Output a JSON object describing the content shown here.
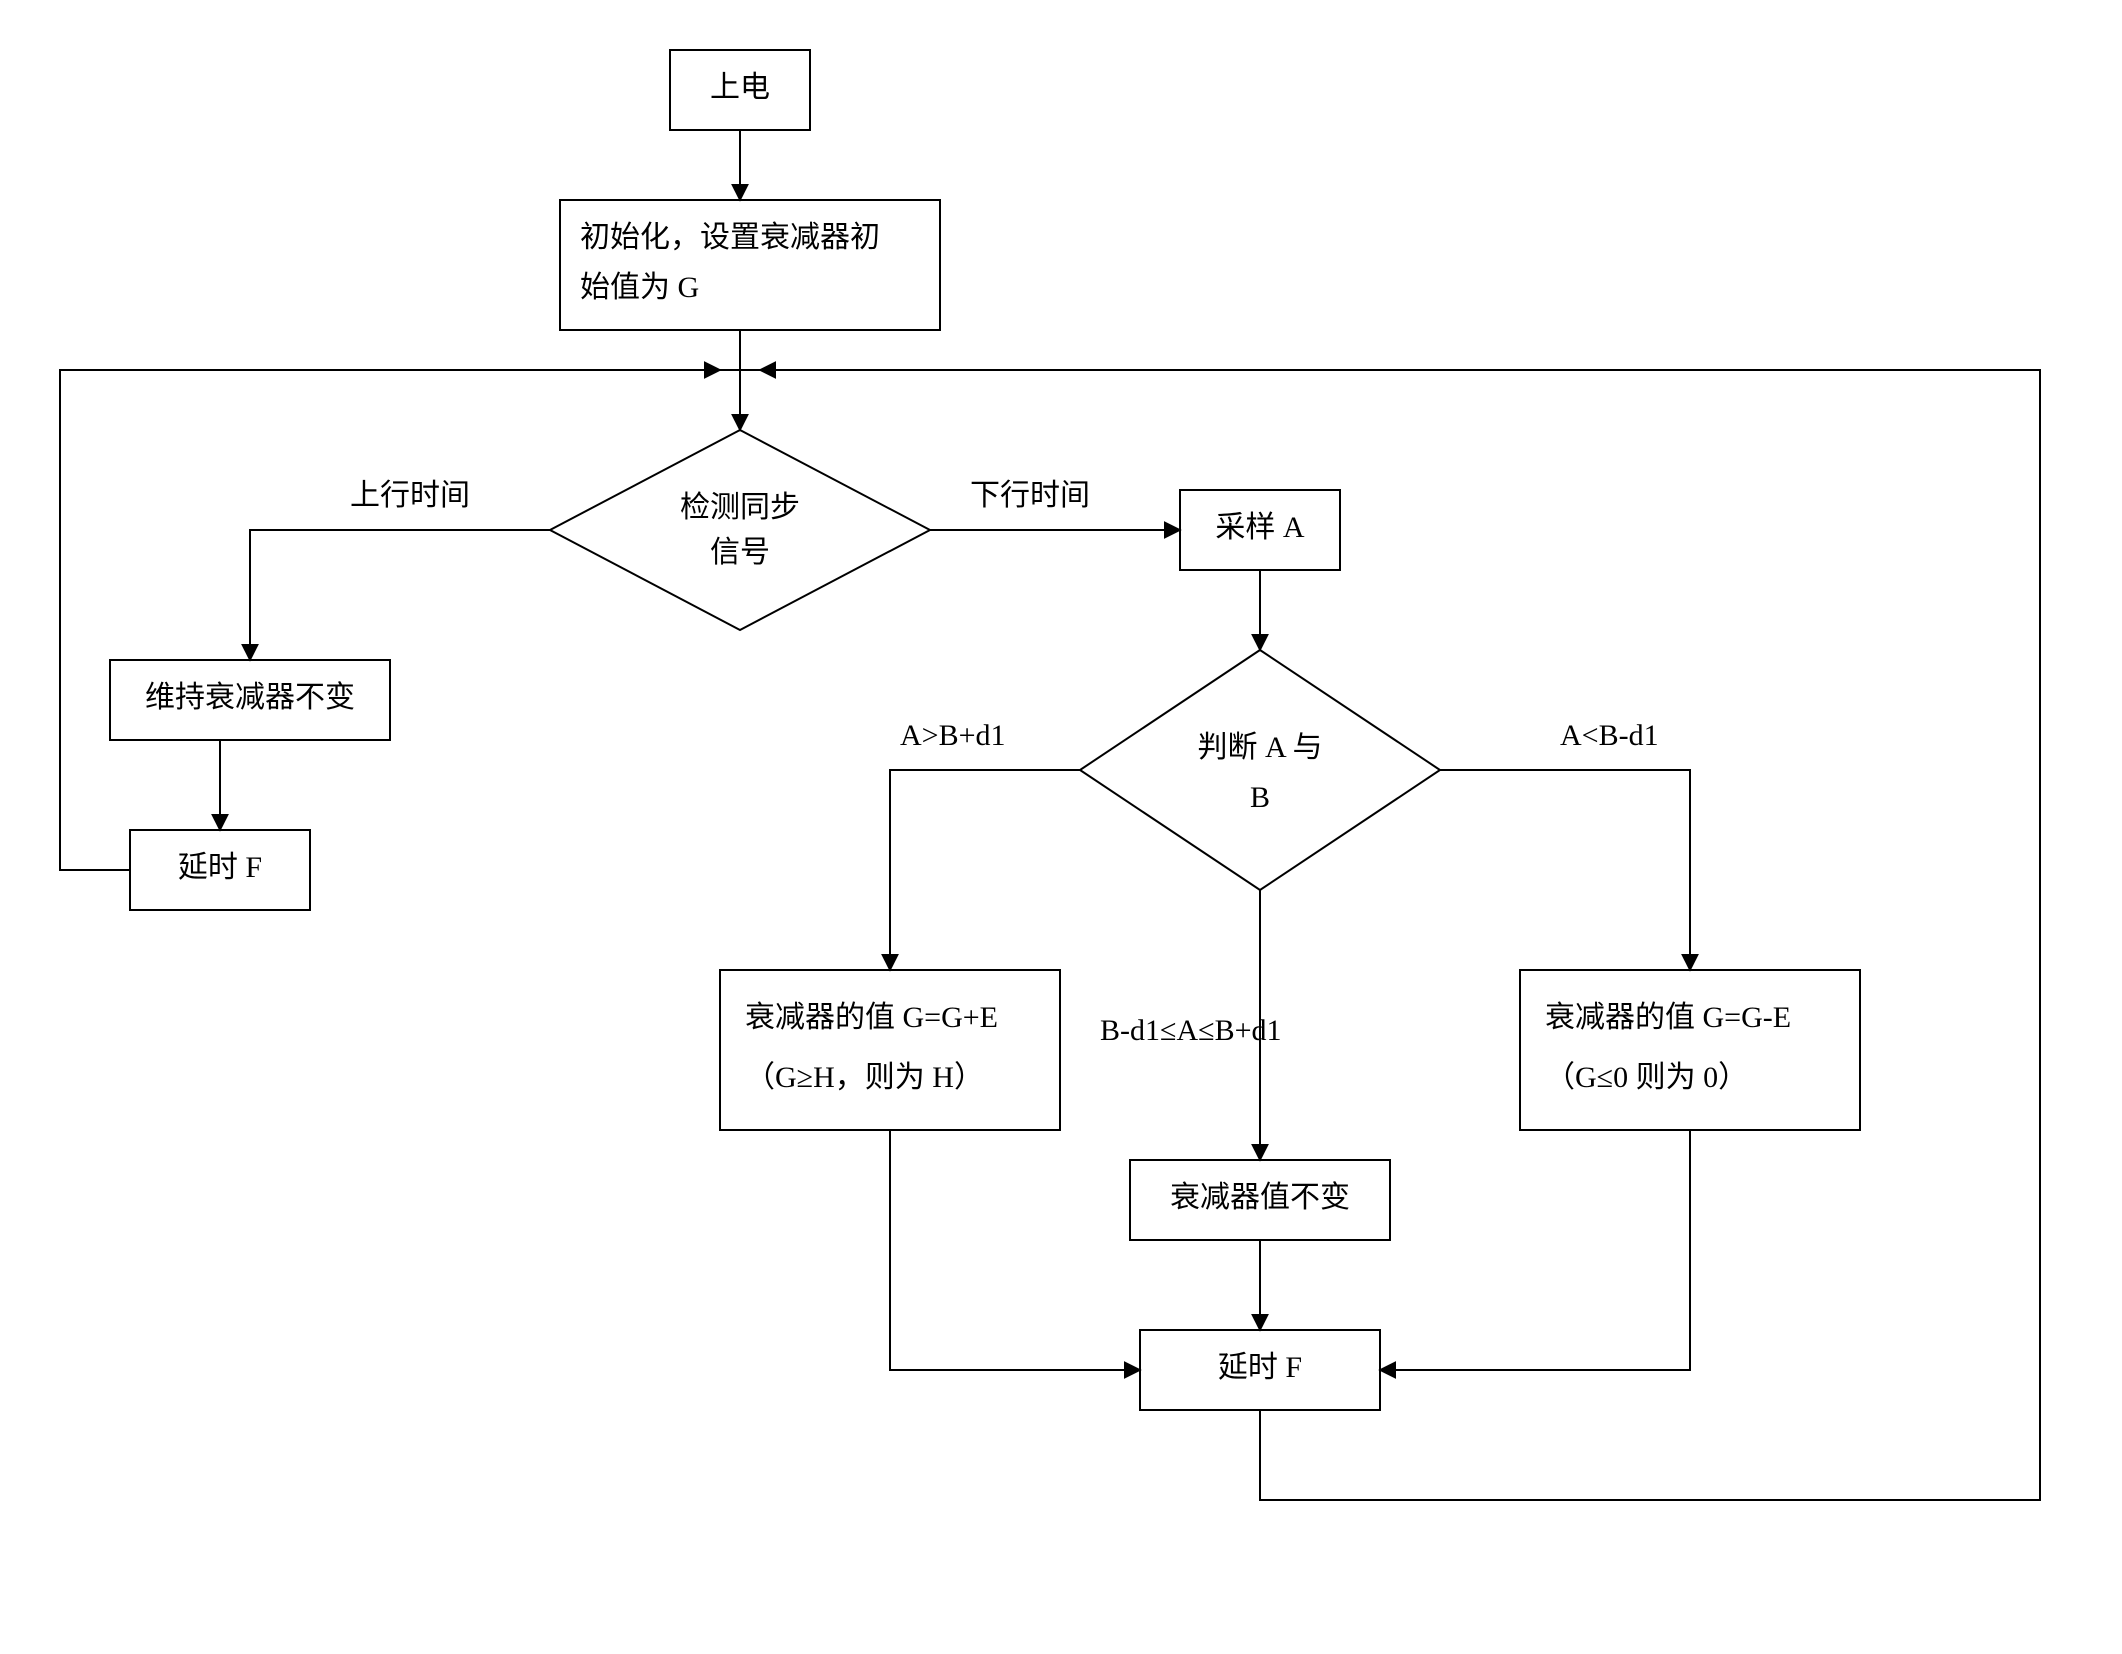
{
  "nodes": {
    "power": {
      "text": "上电"
    },
    "init": {
      "line1": "初始化，设置衰减器初",
      "line2": "始值为 G"
    },
    "detect": {
      "line1": "检测同步",
      "line2": "信号"
    },
    "keep": {
      "text": "维持衰减器不变"
    },
    "delayL": {
      "text": "延时 F"
    },
    "sample": {
      "text": "采样 A"
    },
    "judge": {
      "line1": "判断 A 与",
      "line2": "B"
    },
    "incr": {
      "line1": "衰减器的值 G=G+E",
      "line2": "（G≥H，则为 H）"
    },
    "same": {
      "text": "衰减器值不变"
    },
    "decr": {
      "line1": "衰减器的值 G=G-E",
      "line2": "（G≤0 则为 0）"
    },
    "delayR": {
      "text": "延时 F"
    }
  },
  "edges": {
    "up": "上行时间",
    "down": "下行时间",
    "gt": "A>B+d1",
    "mid": "B-d1≤A≤B+d1",
    "lt": "A<B-d1"
  }
}
